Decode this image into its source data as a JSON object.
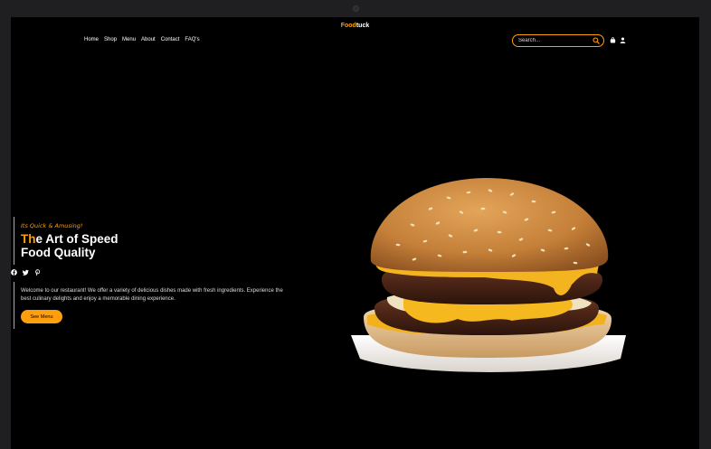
{
  "brand": {
    "part1": "Food",
    "part2": "tuck"
  },
  "nav": {
    "items": [
      "Home",
      "Shop",
      "Menu",
      "About",
      "Contact",
      "FAQ's"
    ]
  },
  "search": {
    "placeholder": "Search..."
  },
  "hero": {
    "tagline": "Its Quick & Amusing!",
    "title_highlight": "Th",
    "title_line1_rest": "e Art of Speed",
    "title_line2": "Food Quality",
    "description": "Welcome to our restaurant! We offer a variety of delicious dishes made with fresh ingredients. Experience the best culinary delights and enjoy a memorable dining experience.",
    "cta_label": "See Menu"
  },
  "colors": {
    "accent": "#ff9f0d",
    "background": "#000000",
    "text": "#ffffff"
  },
  "icons": [
    "search-icon",
    "shopping-bag-icon",
    "user-icon",
    "facebook-icon",
    "twitter-icon",
    "pinterest-icon"
  ]
}
